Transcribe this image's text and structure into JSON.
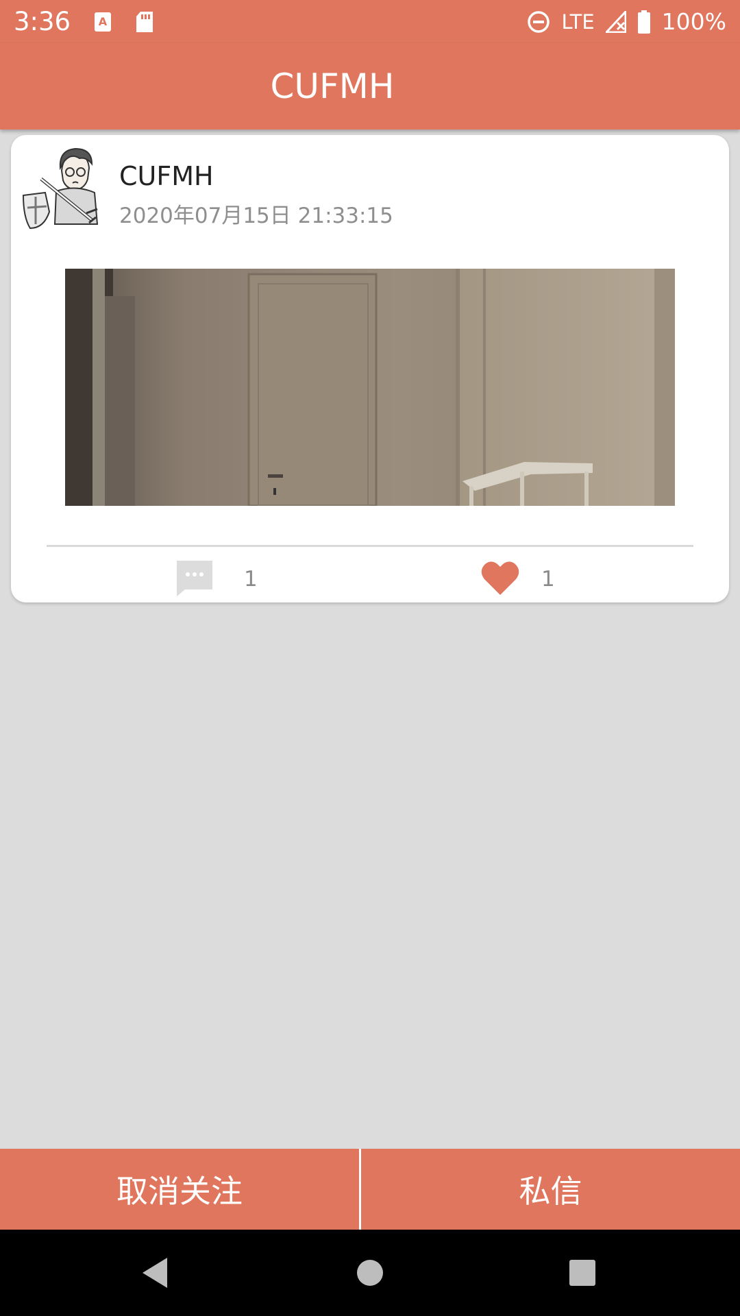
{
  "status_bar": {
    "time": "3:36",
    "network": "LTE",
    "battery": "100%",
    "icons": [
      "text-notification-icon",
      "sd-card-icon",
      "do-not-disturb-icon",
      "signal-icon",
      "battery-icon"
    ]
  },
  "app_bar": {
    "title": "CUFMH"
  },
  "post": {
    "author": "CUFMH",
    "timestamp": "2020年07月15日 21:33:15",
    "comment_count": "1",
    "like_count": "1",
    "liked": true
  },
  "actions": {
    "unfollow_label": "取消关注",
    "message_label": "私信"
  },
  "navigation": {
    "buttons": [
      "back",
      "home",
      "recents"
    ]
  },
  "colors": {
    "accent": "#df765d",
    "background": "#dcdcdc",
    "card": "#ffffff",
    "muted_text": "#8e8e8e",
    "comment_icon": "#dcdcdc"
  }
}
